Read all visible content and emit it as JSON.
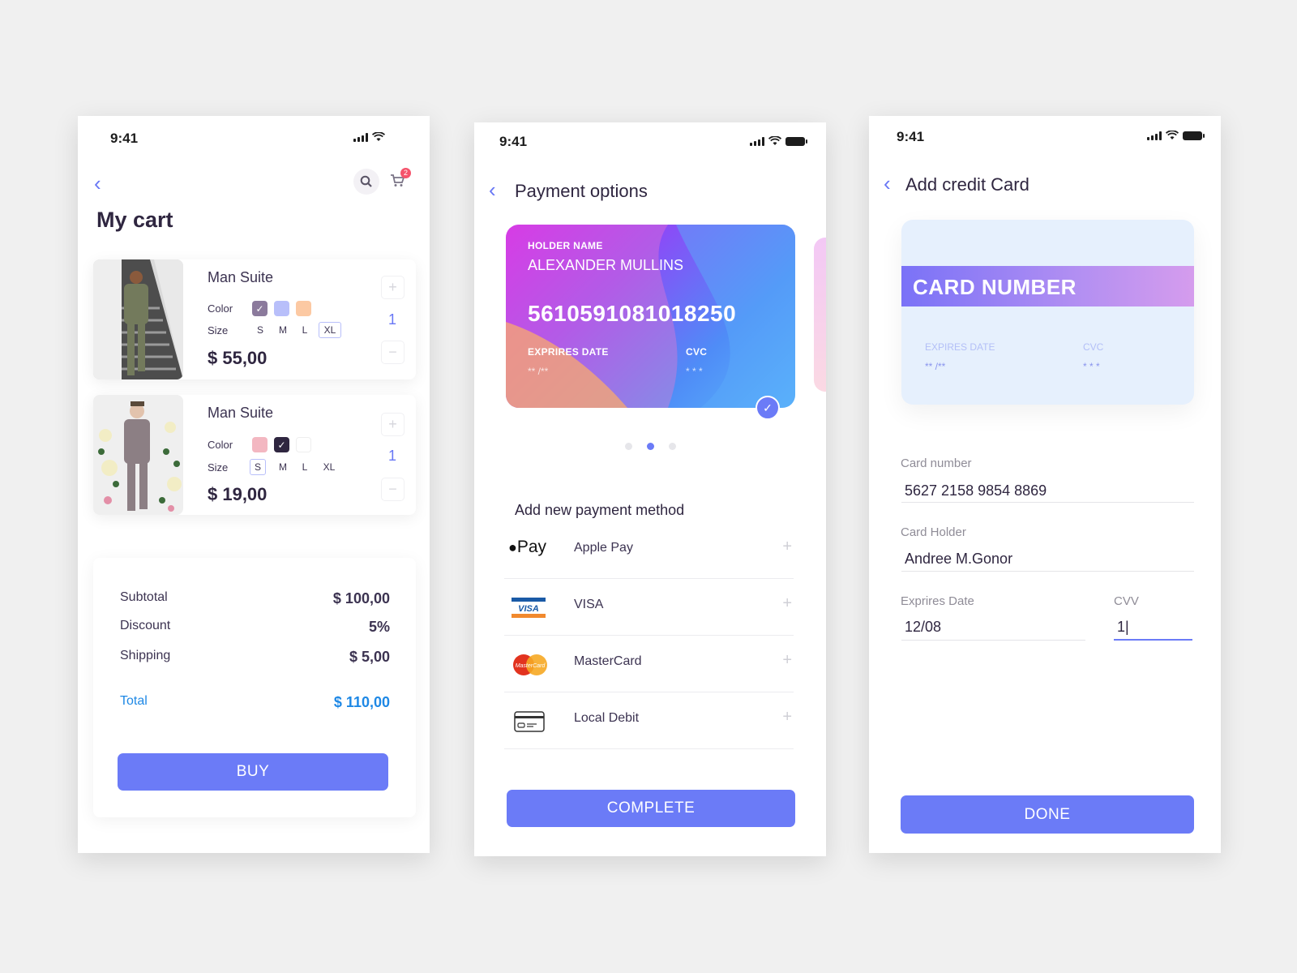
{
  "screens": {
    "cart": {
      "status_time": "9:41",
      "title": "My cart",
      "cart_badge": "2",
      "items": [
        {
          "name": "Man Suite",
          "color_label": "Color",
          "size_label": "Size",
          "sizes": [
            "S",
            "M",
            "L",
            "XL"
          ],
          "selected_size": "XL",
          "colors": [
            "#8b7a9c",
            "#b8bffa",
            "#fcc9a3"
          ],
          "selected_color": 0,
          "price": "$ 55,00",
          "qty": "1",
          "plus": "+",
          "minus": "−"
        },
        {
          "name": "Man Suite",
          "color_label": "Color",
          "size_label": "Size",
          "sizes": [
            "S",
            "M",
            "L",
            "XL"
          ],
          "selected_size": "S",
          "colors": [
            "#f3b7c1",
            "#2f2640",
            "#ffffff"
          ],
          "selected_color": 1,
          "price": "$ 19,00",
          "qty": "1",
          "plus": "+",
          "minus": "−"
        }
      ],
      "summary": {
        "subtotal_label": "Subtotal",
        "subtotal": "$ 100,00",
        "discount_label": "Discount",
        "discount": "5%",
        "shipping_label": "Shipping",
        "shipping": "$ 5,00",
        "total_label": "Total",
        "total": "$ 110,00"
      },
      "buy_label": "BUY"
    },
    "payment": {
      "status_time": "9:41",
      "title": "Payment options",
      "card": {
        "holder_label": "HOLDER NAME",
        "holder": "ALEXANDER MULLINS",
        "number": "5610591081018250",
        "expires_label": "EXPRIRES DATE",
        "expires": "** /**",
        "cvc_label": "CVC",
        "cvc": "* * *"
      },
      "carousel": {
        "count": 3,
        "active": 1
      },
      "section_title": "Add new payment method",
      "methods": [
        {
          "icon": "apple-pay-icon",
          "label": "Apple Pay"
        },
        {
          "icon": "visa-icon",
          "label": "VISA"
        },
        {
          "icon": "mastercard-icon",
          "label": "MasterCard"
        },
        {
          "icon": "debit-card-icon",
          "label": "Local Debit"
        }
      ],
      "plus": "+",
      "complete_label": "COMPLETE"
    },
    "add_card": {
      "status_time": "9:41",
      "title": "Add credit Card",
      "card": {
        "number_label": "CARD NUMBER",
        "expires_label": "EXPIRES DATE",
        "expires": "** /**",
        "cvc_label": "CVC",
        "cvc": "* * *"
      },
      "fields": {
        "card_number_label": "Card number",
        "card_number": "5627 2158 9854 8869",
        "holder_label": "Card Holder",
        "holder": "Andree M.Gonor",
        "expires_label": "Exprires Date",
        "expires": "12/08",
        "cvv_label": "CVV",
        "cvv": "1|"
      },
      "done_label": "DONE"
    }
  },
  "colors": {
    "accent": "#6b7bf7",
    "total": "#1e88e5",
    "badge": "#f5536b"
  }
}
